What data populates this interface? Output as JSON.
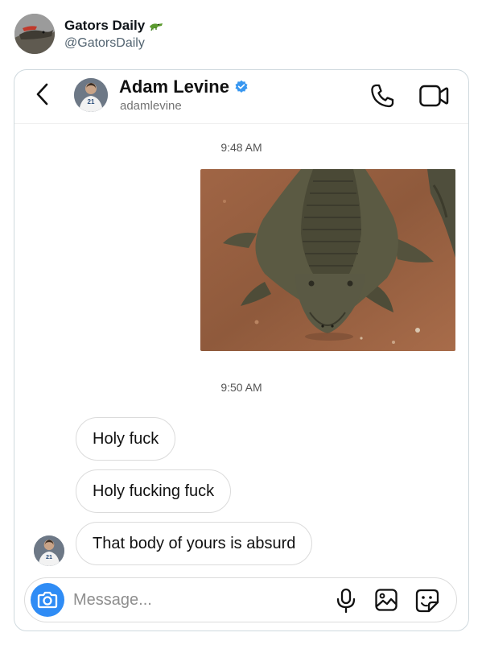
{
  "post": {
    "author_name": "Gators Daily",
    "author_handle": "@GatorsDaily",
    "name_emoji": "🐊"
  },
  "dm": {
    "contact_name": "Adam Levine",
    "contact_username": "adamlevine",
    "verified": true,
    "timestamp_1": "9:48 AM",
    "timestamp_2": "9:50 AM",
    "messages": [
      "Holy fuck",
      "Holy fucking fuck",
      "That body of yours is absurd"
    ],
    "composer_placeholder": "Message...",
    "jersey_number": "21"
  },
  "colors": {
    "verified_blue": "#3897f0",
    "camera_blue": "#2f8cf5"
  }
}
